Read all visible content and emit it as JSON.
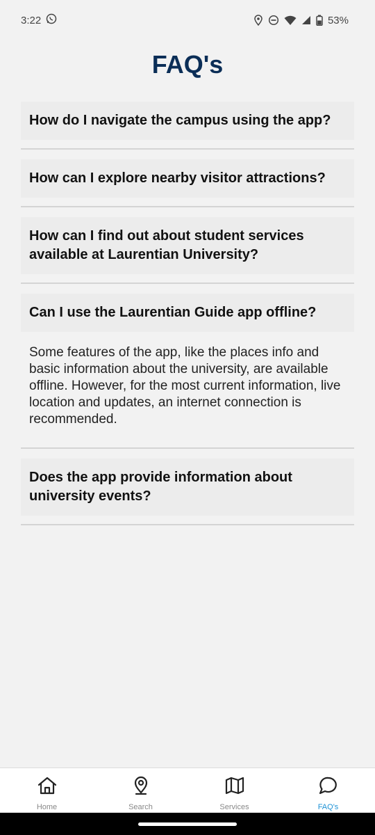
{
  "status_bar": {
    "time": "3:22",
    "battery": "53%",
    "icons": [
      "whatsapp-icon",
      "location-icon",
      "dnd-icon",
      "wifi-icon",
      "signal-icon",
      "battery-icon"
    ]
  },
  "page": {
    "title": "FAQ's"
  },
  "faqs": [
    {
      "question": "How do I navigate the campus using the app?",
      "answer": "",
      "expanded": false
    },
    {
      "question": "How can I explore nearby visitor attractions?",
      "answer": "",
      "expanded": false
    },
    {
      "question": "How can I find out about student services available at Laurentian University?",
      "answer": "",
      "expanded": false
    },
    {
      "question": "Can I use the Laurentian Guide app offline?",
      "answer": "Some features of the app, like the places info and basic information about the university, are available offline. However, for the most current information, live location and updates, an internet connection is recommended.",
      "expanded": true
    },
    {
      "question": "Does the app provide information about university events?",
      "answer": "",
      "expanded": false
    }
  ],
  "tab_bar": {
    "tabs": [
      {
        "label": "Home",
        "icon": "home-icon",
        "active": false
      },
      {
        "label": "Search",
        "icon": "map-pin-icon",
        "active": false
      },
      {
        "label": "Services",
        "icon": "map-icon",
        "active": false
      },
      {
        "label": "FAQ's",
        "icon": "chat-icon",
        "active": true
      }
    ],
    "active_color": "#1f93d6",
    "inactive_color": "#888888"
  },
  "colors": {
    "title": "#0b2e57",
    "background": "#f2f2f2"
  }
}
